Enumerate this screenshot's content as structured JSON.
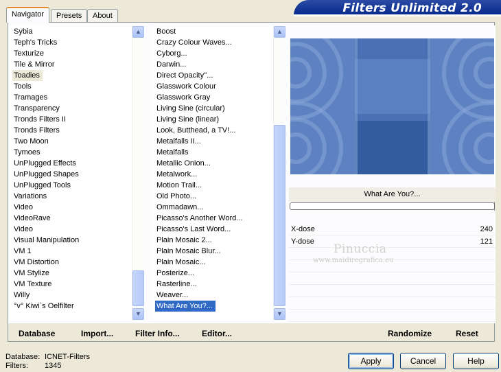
{
  "tabs": [
    "Navigator",
    "Presets",
    "About"
  ],
  "banner_title": "Filters Unlimited 2.0",
  "categories": {
    "items": [
      "Sybia",
      "Teph's Tricks",
      "Texturize",
      "Tile & Mirror",
      "Toadies",
      "Tools",
      "Tramages",
      "Transparency",
      "Tronds Filters II",
      "Tronds Filters",
      "Two Moon",
      "Tymoes",
      "UnPlugged Effects",
      "UnPlugged Shapes",
      "UnPlugged Tools",
      "Variations",
      "Video",
      "VideoRave",
      "Video",
      "Visual Manipulation",
      "VM 1",
      "VM Distortion",
      "VM Stylize",
      "VM Texture",
      "Willy",
      "°v° Kiwi`s Oelfilter"
    ],
    "selected": "Toadies"
  },
  "filters": {
    "items": [
      "Boost",
      "Crazy Colour Waves...",
      "Cyborg...",
      "Darwin...",
      "Direct Opacity''...",
      "Glasswork Colour",
      "Glasswork Gray",
      "Living Sine (circular)",
      "Living Sine (linear)",
      "Look, Butthead, a TV!...",
      "Metalfalls II...",
      "Metalfalls",
      "Metallic Onion...",
      "Metalwork...",
      "Motion Trail...",
      "Old Photo...",
      "Ommadawn...",
      "Picasso's Another Word...",
      "Picasso's Last Word...",
      "Plain Mosaic 2...",
      "Plain Mosaic Blur...",
      "Plain Mosaic...",
      "Posterize...",
      "Rasterline...",
      "Weaver...",
      "What Are You?..."
    ],
    "selected": "What Are You?..."
  },
  "preview_caption": "What Are You?...",
  "params": [
    {
      "label": "X-dose",
      "value": "240"
    },
    {
      "label": "Y-dose",
      "value": "121"
    }
  ],
  "watermark": {
    "name": "Pinuccia",
    "url": "www.maidiregrafica.eu"
  },
  "actions": {
    "database": "Database",
    "import": "Import...",
    "filter_info": "Filter Info...",
    "editor": "Editor...",
    "randomize": "Randomize",
    "reset": "Reset"
  },
  "status": {
    "database_label": "Database:",
    "database_value": "ICNET-Filters",
    "filters_label": "Filters:",
    "filters_value": "1345"
  },
  "buttons": {
    "apply": "Apply",
    "cancel": "Cancel",
    "help": "Help"
  },
  "colors": {
    "banner": "#0a2a8c",
    "selection": "#316ac5",
    "tab_accent": "#e68b2c"
  }
}
